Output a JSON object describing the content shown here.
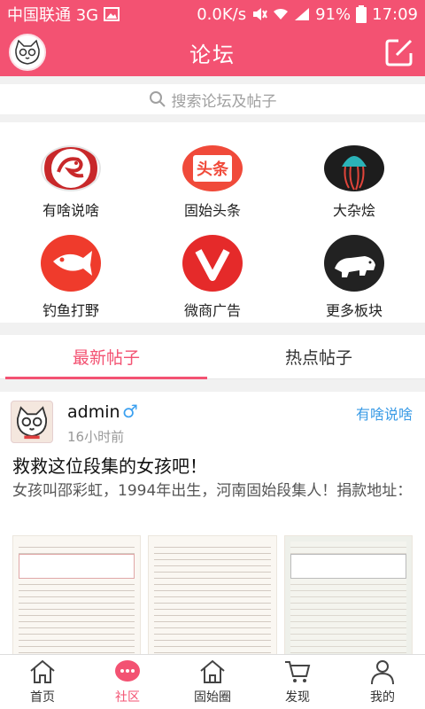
{
  "statusbar": {
    "carrier": "中国联通 3G",
    "speed": "0.0K/s",
    "battery": "91%",
    "time": "17:09"
  },
  "header": {
    "title": "论坛"
  },
  "search": {
    "placeholder": "搜索论坛及帖子"
  },
  "boards": [
    {
      "label": "有啥说啥",
      "icon": "phoenix-logo-icon",
      "color": "#c8282a"
    },
    {
      "label": "固始头条",
      "icon": "toutiao-icon",
      "color": "#f04a3a"
    },
    {
      "label": "大杂烩",
      "icon": "jellyfish-icon",
      "color": "#1d1d1d"
    },
    {
      "label": "钓鱼打野",
      "icon": "fish-icon",
      "color": "#ef3b2c"
    },
    {
      "label": "微商广告",
      "icon": "v-logo-icon",
      "color": "#e52a2a"
    },
    {
      "label": "更多板块",
      "icon": "polar-bear-icon",
      "color": "#222222"
    }
  ],
  "tabs": [
    {
      "label": "最新帖子",
      "active": true
    },
    {
      "label": "热点帖子",
      "active": false
    }
  ],
  "post": {
    "author": "admin",
    "gender": "♂",
    "time": "16小时前",
    "board": "有啥说啥",
    "title": "救救这位段集的女孩吧！",
    "excerpt": "女孩叫邵彩虹，1994年出生，河南固始段集人！捐款地址："
  },
  "bottom_nav": [
    {
      "label": "首页",
      "icon": "home-icon",
      "active": false
    },
    {
      "label": "社区",
      "icon": "chat-bubble-icon",
      "active": true
    },
    {
      "label": "固始圈",
      "icon": "house-icon",
      "active": false
    },
    {
      "label": "发现",
      "icon": "cart-icon",
      "active": false
    },
    {
      "label": "我的",
      "icon": "user-icon",
      "active": false
    }
  ],
  "colors": {
    "accent": "#f35272",
    "link": "#3a9be6"
  }
}
